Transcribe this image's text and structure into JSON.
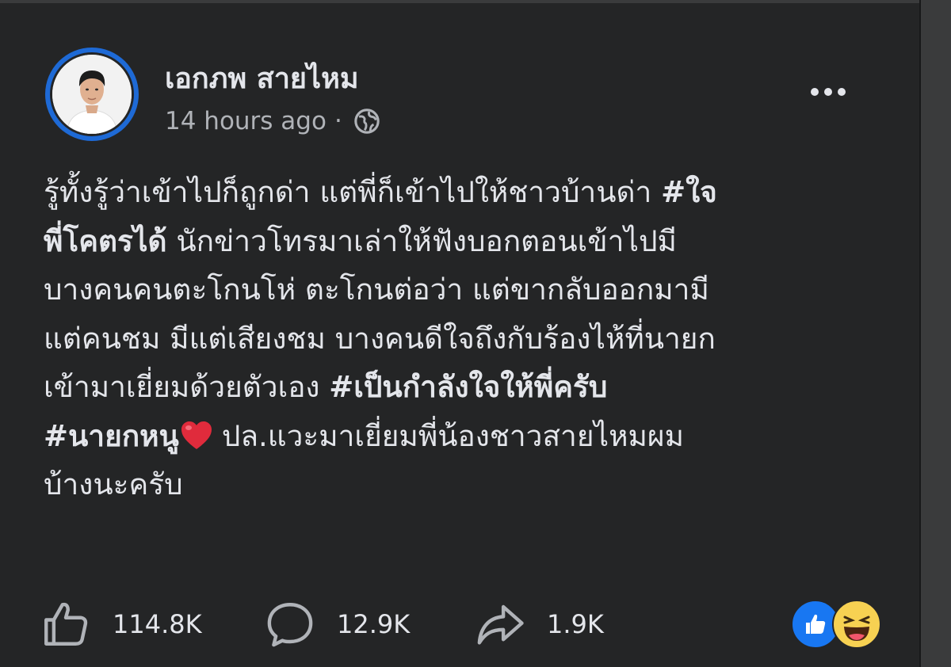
{
  "post": {
    "author": "เอกภพ สายไหม",
    "time": "14 hours ago",
    "meta_separator": "·",
    "privacy_icon": "globe-icon",
    "more_icon": "more-options-icon",
    "text_lines": [
      [
        {
          "t": "รู้ทั้งรู้ว่าเข้าไปก็ถูกด่า แต่พี่ก็เข้าไปให้ชาวบ้านด่า "
        },
        {
          "t": "#ใจ",
          "tag": true
        }
      ],
      [
        {
          "t": "พี่โคตรได้",
          "tag": true
        },
        {
          "t": " นักข่าวโทรมาเล่าให้ฟังบอกตอนเข้าไปมี"
        }
      ],
      [
        {
          "t": "บางคนคนตะโกนโห่ ตะโกนต่อว่า แต่ขากลับออกมามี"
        }
      ],
      [
        {
          "t": "แต่คนชม มีแต่เสียงชม บางคนดีใจถึงกับร้องไห้ที่นายก"
        }
      ],
      [
        {
          "t": "เข้ามาเยี่ยมด้วยตัวเอง "
        },
        {
          "t": "#เป็นกำลังใจให้พี่ครับ",
          "tag": true
        }
      ],
      [
        {
          "t": "#นายกหนู",
          "tag": true
        },
        {
          "heart": true
        },
        {
          "t": "ปล.แวะมาเยี่ยมพี่น้องชาวสายไหมผม"
        }
      ],
      [
        {
          "t": "บ้างนะครับ"
        }
      ]
    ],
    "likes": "114.8K",
    "comments": "12.9K",
    "shares": "1.9K",
    "reaction_icons": [
      "like-reaction-icon",
      "haha-reaction-icon"
    ]
  },
  "colors": {
    "background": "#242526",
    "text": "#e4e6eb",
    "secondary_text": "#b0b3b8",
    "like_blue": "#1877f2",
    "heart_red": "#e02b3c",
    "haha_yellow": "#f7d152"
  }
}
